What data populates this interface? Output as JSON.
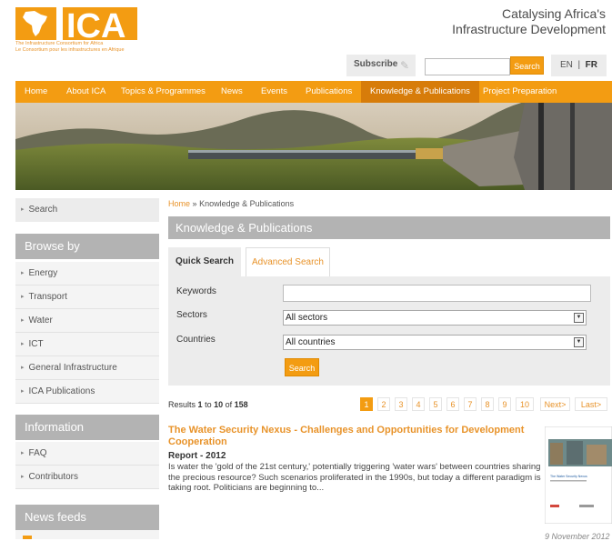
{
  "header": {
    "logo_text": "ICA",
    "logo_sub_en": "The Infrastructure Consortium for Africa",
    "logo_sub_fr": "Le Consortium pour les infrastructures en Afrique",
    "tagline_line1": "Catalysing Africa's",
    "tagline_line2": "Infrastructure Development",
    "subscribe_label": "Subscribe",
    "search_value": "",
    "search_button": "Search",
    "lang_en": "EN",
    "lang_sep": "|",
    "lang_fr": "FR"
  },
  "nav": {
    "items": [
      {
        "label": "Home"
      },
      {
        "label": "About ICA"
      },
      {
        "label": "Topics & Programmes"
      },
      {
        "label": "News"
      },
      {
        "label": "Events"
      },
      {
        "label": "Publications"
      },
      {
        "label": "Knowledge & Publications",
        "active": true
      },
      {
        "label": "Project Preparation"
      }
    ]
  },
  "sidebar": {
    "search_label": "Search",
    "browse_title": "Browse by",
    "browse_items": [
      {
        "label": "Energy"
      },
      {
        "label": "Transport"
      },
      {
        "label": "Water"
      },
      {
        "label": "ICT"
      },
      {
        "label": "General Infrastructure"
      },
      {
        "label": "ICA Publications"
      }
    ],
    "info_title": "Information",
    "info_items": [
      {
        "label": "FAQ"
      },
      {
        "label": "Contributors"
      }
    ],
    "feeds_title": "News feeds"
  },
  "main": {
    "breadcrumb_home": "Home",
    "breadcrumb_sep": "»",
    "breadcrumb_current": "Knowledge & Publications",
    "page_title": "Knowledge & Publications",
    "tabs": [
      {
        "label": "Quick Search",
        "active": true
      },
      {
        "label": "Advanced Search"
      }
    ],
    "form": {
      "keywords_label": "Keywords",
      "keywords_value": "",
      "sectors_label": "Sectors",
      "sectors_value": "All sectors",
      "countries_label": "Countries",
      "countries_value": "All countries",
      "search_button": "Search"
    },
    "results": {
      "prefix": "Results",
      "from": "1",
      "to_word": "to",
      "to": "10",
      "of_word": "of",
      "total": "158"
    },
    "pager": {
      "pages": [
        "1",
        "2",
        "3",
        "4",
        "5",
        "6",
        "7",
        "8",
        "9",
        "10"
      ],
      "current": "1",
      "next": "Next>",
      "last": "Last>"
    },
    "result": {
      "title": "The Water Security Nexus - Challenges and Opportunities for Development Cooperation",
      "type": "Report",
      "sep": "-",
      "year": "2012",
      "description": "Is water the 'gold of the 21st century,' potentially triggering 'water wars' between countries sharing the precious resource? Such scenarios proliferated in the 1990s, but today a different paradigm is taking root. Politicians are beginning to...",
      "thumb_title": "The Water Security Nexus",
      "date": "9 November 2012"
    }
  },
  "colors": {
    "accent": "#f39c12",
    "accent_dark": "#d77c0a",
    "link": "#e8932a",
    "panel_grey": "#b3b3b3",
    "light_grey": "#ececec"
  }
}
